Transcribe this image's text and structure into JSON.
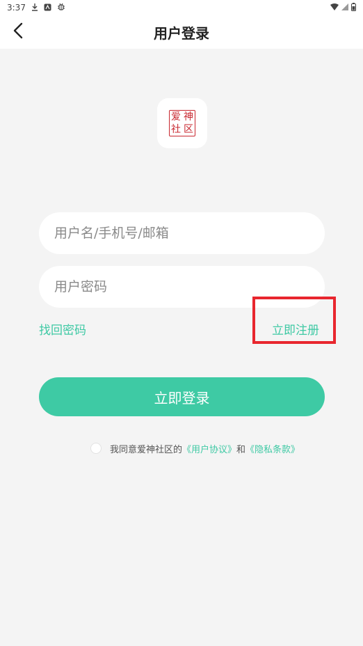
{
  "status_bar": {
    "time": "3:37",
    "icons_left": [
      "download-icon",
      "notification-a-icon",
      "notification-bug-icon"
    ],
    "icons_right": [
      "wifi-icon",
      "signal-icon",
      "battery-icon"
    ]
  },
  "nav": {
    "title": "用户登录",
    "back_icon": "chevron-left-icon"
  },
  "logo": {
    "chars": [
      "爱",
      "神",
      "社",
      "区"
    ],
    "seal_color": "#c8262e"
  },
  "form": {
    "username_placeholder": "用户名/手机号/邮箱",
    "username_value": "",
    "password_placeholder": "用户密码",
    "password_value": "",
    "forgot_password": "找回密码",
    "register": "立即注册",
    "login_button": "立即登录"
  },
  "agreement": {
    "checked": false,
    "prefix": "我同意爱神社区的",
    "user_agreement": "《用户协议》",
    "and": "和",
    "privacy_policy": "《隐私条款》"
  },
  "colors": {
    "accent": "#3ecaa4",
    "link": "#3ec9a4",
    "background": "#f4f4f4",
    "highlight": "#e8262e"
  }
}
